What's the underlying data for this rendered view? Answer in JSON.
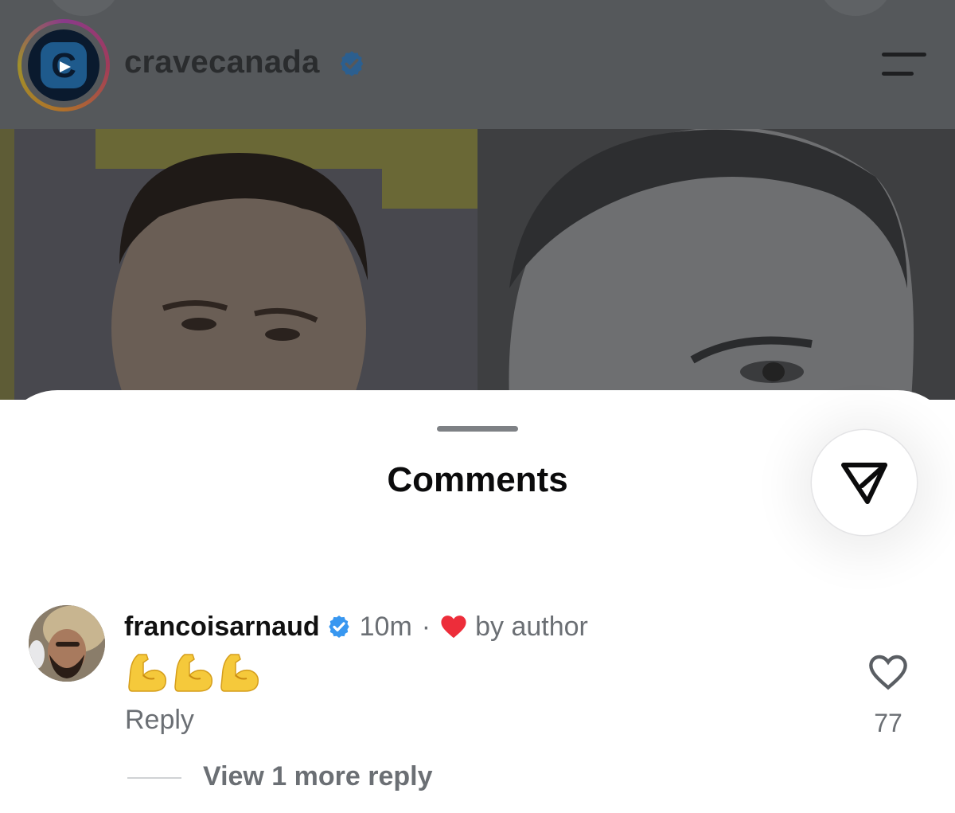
{
  "post": {
    "username": "cravecanada",
    "verified": true,
    "avatar_letter": "C",
    "menu_icon": "hamburger-icon"
  },
  "sheet": {
    "title": "Comments",
    "share_icon": "paper-plane-icon"
  },
  "comment": {
    "username": "francoisarnaud",
    "verified": true,
    "time": "10m",
    "separator": "·",
    "liked_by_author_icon": "heart-filled-icon",
    "liked_by_author_label": "by author",
    "body_emoji_count": 3,
    "body_emoji_icon": "flexed-biceps-emoji",
    "reply_label": "Reply",
    "like_icon": "heart-outline-icon",
    "like_count": "77",
    "view_replies_label": "View 1 more reply"
  },
  "colors": {
    "verified_blue": "#3897f0",
    "heart_red": "#ed2d3a",
    "muted_text": "#6b6f74",
    "emoji_yellow": "#f5c93b"
  }
}
